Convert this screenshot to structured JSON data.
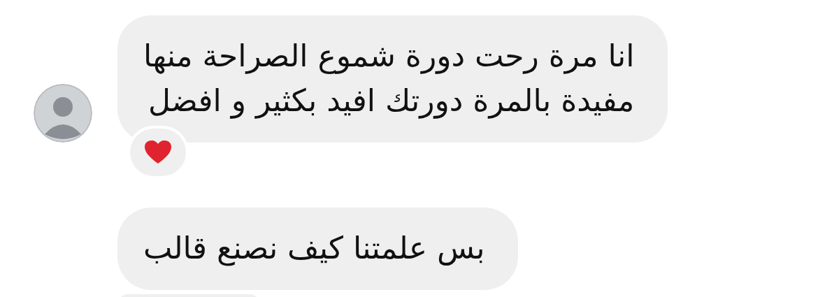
{
  "messages": [
    {
      "text": "انا مرة رحت دورة شموع الصراحة منها\nمفيدة بالمرة دورتك افيد بكثير و افضل",
      "show_avatar": true,
      "reaction": {
        "kind": "heart"
      }
    },
    {
      "text": "بس علمتنا كيف نصنع قالب",
      "show_avatar": false,
      "reaction": {
        "kind": "partial"
      }
    }
  ]
}
